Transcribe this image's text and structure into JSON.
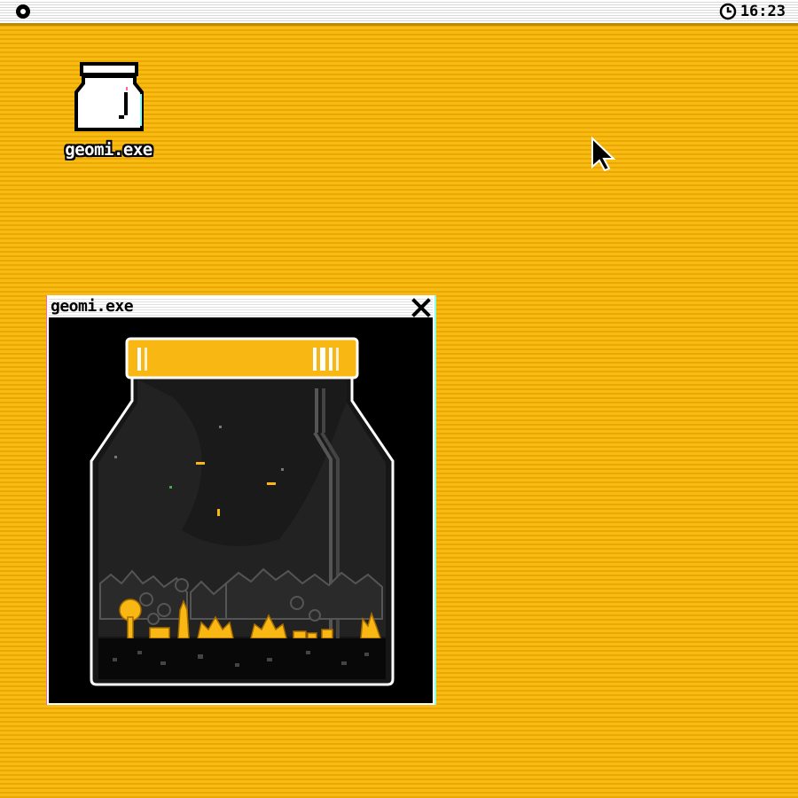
{
  "menubar": {
    "apple_icon": "circle-menu-icon",
    "clock_icon": "clock-icon",
    "time": "16:23"
  },
  "desktop": {
    "icons": [
      {
        "label": "geomi.exe",
        "icon": "jar-icon"
      }
    ],
    "cursor": "arrow-cursor"
  },
  "window": {
    "title": "geomi.exe",
    "close_icon": "close-icon",
    "content": "terrarium-jar-scene"
  },
  "colors": {
    "desktop_yellow": "#f7b70a",
    "accent_yellow": "#f9b713",
    "window_bg": "#000000"
  }
}
